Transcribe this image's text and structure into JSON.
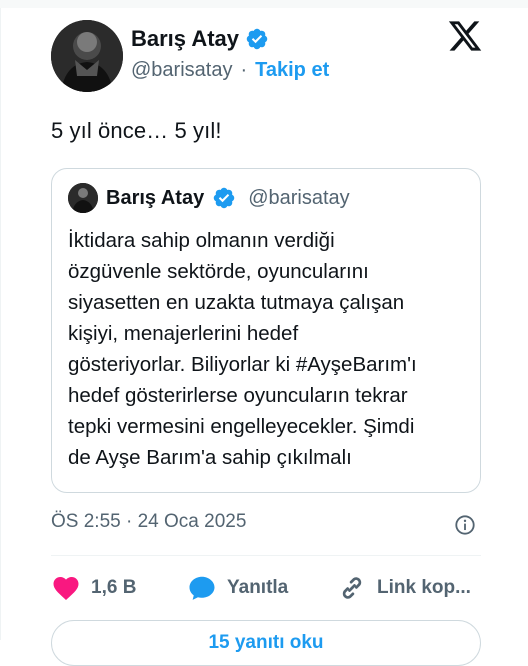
{
  "author": {
    "name": "Barış Atay",
    "handle": "@barisatay",
    "separator": "·",
    "follow_label": "Takip et"
  },
  "tweet": {
    "text": "5 yıl önce… 5 yıl!"
  },
  "quoted": {
    "name": "Barış Atay",
    "handle": "@barisatay",
    "lines": [
      "İktidara sahip olmanın verdiği",
      "özgüvenle sektörde, oyuncularını",
      "siyasetten en uzakta tutmaya çalışan",
      "kişiyi, menajerlerini hedef",
      "gösteriyorlar. Biliyorlar ki #AyşeBarım'ı",
      "hedef gösterirlerse oyuncuların tekrar",
      "tepki vermesini engelleyecekler. Şimdi",
      "de Ayşe Barım'a sahip çıkılmalı"
    ]
  },
  "meta": {
    "timestamp": "ÖS 2:55 · 24 Oca 2025"
  },
  "actions": {
    "like_count": "1,6 B",
    "reply_label": "Yanıtla",
    "copy_link_label": "Link kop..."
  },
  "replies_button": "15 yanıtı oku",
  "colors": {
    "accent": "#1d9bf0",
    "like": "#f91880",
    "text": "#0f1419",
    "muted": "#536471",
    "border": "#cfd9de"
  }
}
